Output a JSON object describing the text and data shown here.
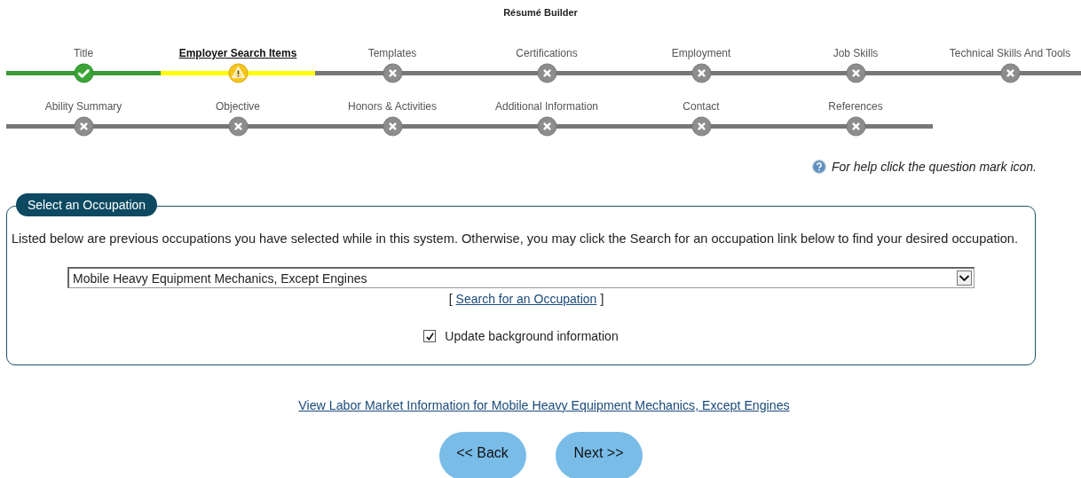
{
  "page_title": "Résumé Builder",
  "step_rows": [
    [
      {
        "label": "Title",
        "kind": "complete",
        "selected": false
      },
      {
        "label": "Employer Search Items",
        "kind": "warning",
        "selected": true
      },
      {
        "label": "Templates",
        "kind": "incomplete",
        "selected": false
      },
      {
        "label": "Certifications",
        "kind": "incomplete",
        "selected": false
      },
      {
        "label": "Employment",
        "kind": "incomplete",
        "selected": false
      },
      {
        "label": "Job Skills",
        "kind": "incomplete",
        "selected": false
      },
      {
        "label": "Technical Skills And Tools",
        "kind": "incomplete",
        "selected": false
      }
    ],
    [
      {
        "label": "Ability Summary",
        "kind": "incomplete",
        "selected": false
      },
      {
        "label": "Objective",
        "kind": "incomplete",
        "selected": false
      },
      {
        "label": "Honors & Activities",
        "kind": "incomplete",
        "selected": false
      },
      {
        "label": "Additional Information",
        "kind": "incomplete",
        "selected": false
      },
      {
        "label": "Contact",
        "kind": "incomplete",
        "selected": false
      },
      {
        "label": "References",
        "kind": "incomplete",
        "selected": false
      }
    ]
  ],
  "help_text": "For help click the question mark icon.",
  "section": {
    "legend": "Select an Occupation",
    "instructions": "Listed below are previous occupations you have selected while in this system. Otherwise, you may click the Search for an occupation link below to find your desired occupation.",
    "occupation_select": {
      "value": "Mobile Heavy Equipment Mechanics, Except Engines"
    },
    "search_link": {
      "open": "[",
      "label": "Search for an Occupation",
      "close": "]"
    },
    "update_checkbox": {
      "label": "Update background information",
      "checked": true
    }
  },
  "labor_market_link": "View Labor Market Information for Mobile Heavy Equipment Mechanics, Except Engines",
  "buttons": [
    "<< Back",
    "Next >>"
  ]
}
